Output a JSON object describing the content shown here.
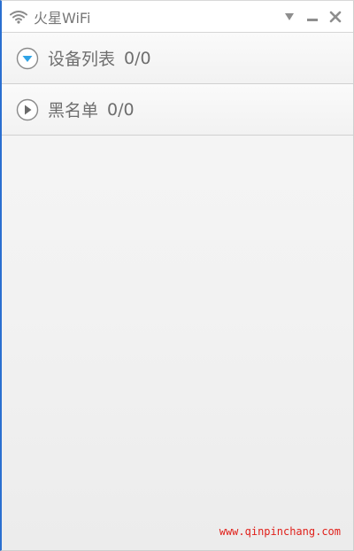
{
  "window": {
    "title": "火星WiFi",
    "icon": "wifi-icon",
    "controls": [
      "dropdown-menu-icon",
      "minimize-icon",
      "close-icon"
    ]
  },
  "sections": [
    {
      "label": "设备列表",
      "count": "0/0",
      "icon": "expand-down-icon",
      "expanded": true
    },
    {
      "label": "黑名单",
      "count": "0/0",
      "icon": "collapse-right-icon",
      "expanded": false
    }
  ],
  "watermark": "www.qinpinchang.com",
  "colors": {
    "accent": "#2fa3e6",
    "text": "#6e6e6e",
    "border_accent": "#2a6fd0",
    "watermark": "#e0201a"
  }
}
